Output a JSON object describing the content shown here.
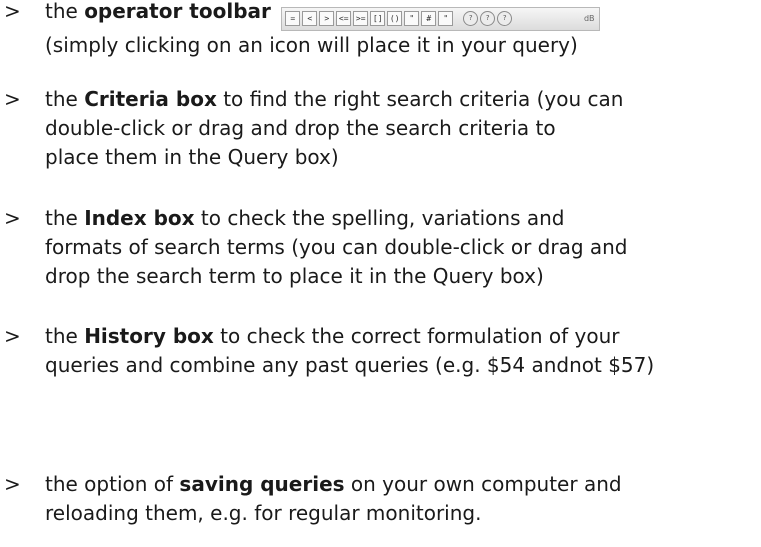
{
  "bullet_symbol": ">",
  "items": [
    {
      "lines": [
        [
          "the ",
          {
            "b": "operator toolbar"
          }
        ],
        [
          "(simply clicking on an icon will place it in your query)"
        ]
      ]
    },
    {
      "lines": [
        [
          "the ",
          {
            "b": "Criteria box"
          },
          " to find the right search criteria (you can"
        ],
        [
          "double-click or drag and drop the search criteria to"
        ],
        [
          "place them in the Query box)"
        ]
      ]
    },
    {
      "lines": [
        [
          "the ",
          {
            "b": "Index box"
          },
          " to check the spelling, variations and"
        ],
        [
          "formats of search terms (you can double-click or drag and"
        ],
        [
          "drop the search term to place it in the Query box)"
        ]
      ]
    },
    {
      "lines": [
        [
          "the ",
          {
            "b": "History box"
          },
          " to check the correct formulation of your"
        ],
        [
          "queries and combine any past queries (e.g. $54 andnot $57)"
        ]
      ]
    },
    {
      "lines": [
        [
          "the option of ",
          {
            "b": "saving queries"
          },
          " on your own computer and"
        ],
        [
          "reloading them, e.g. for regular monitoring."
        ]
      ]
    }
  ],
  "toolbar": {
    "buttons": [
      "=",
      "<",
      ">",
      "<=",
      ">=",
      "[]",
      "()",
      "\"",
      "#",
      "\""
    ],
    "circles": [
      "?",
      "?",
      "?"
    ],
    "end_icon": "dB"
  }
}
